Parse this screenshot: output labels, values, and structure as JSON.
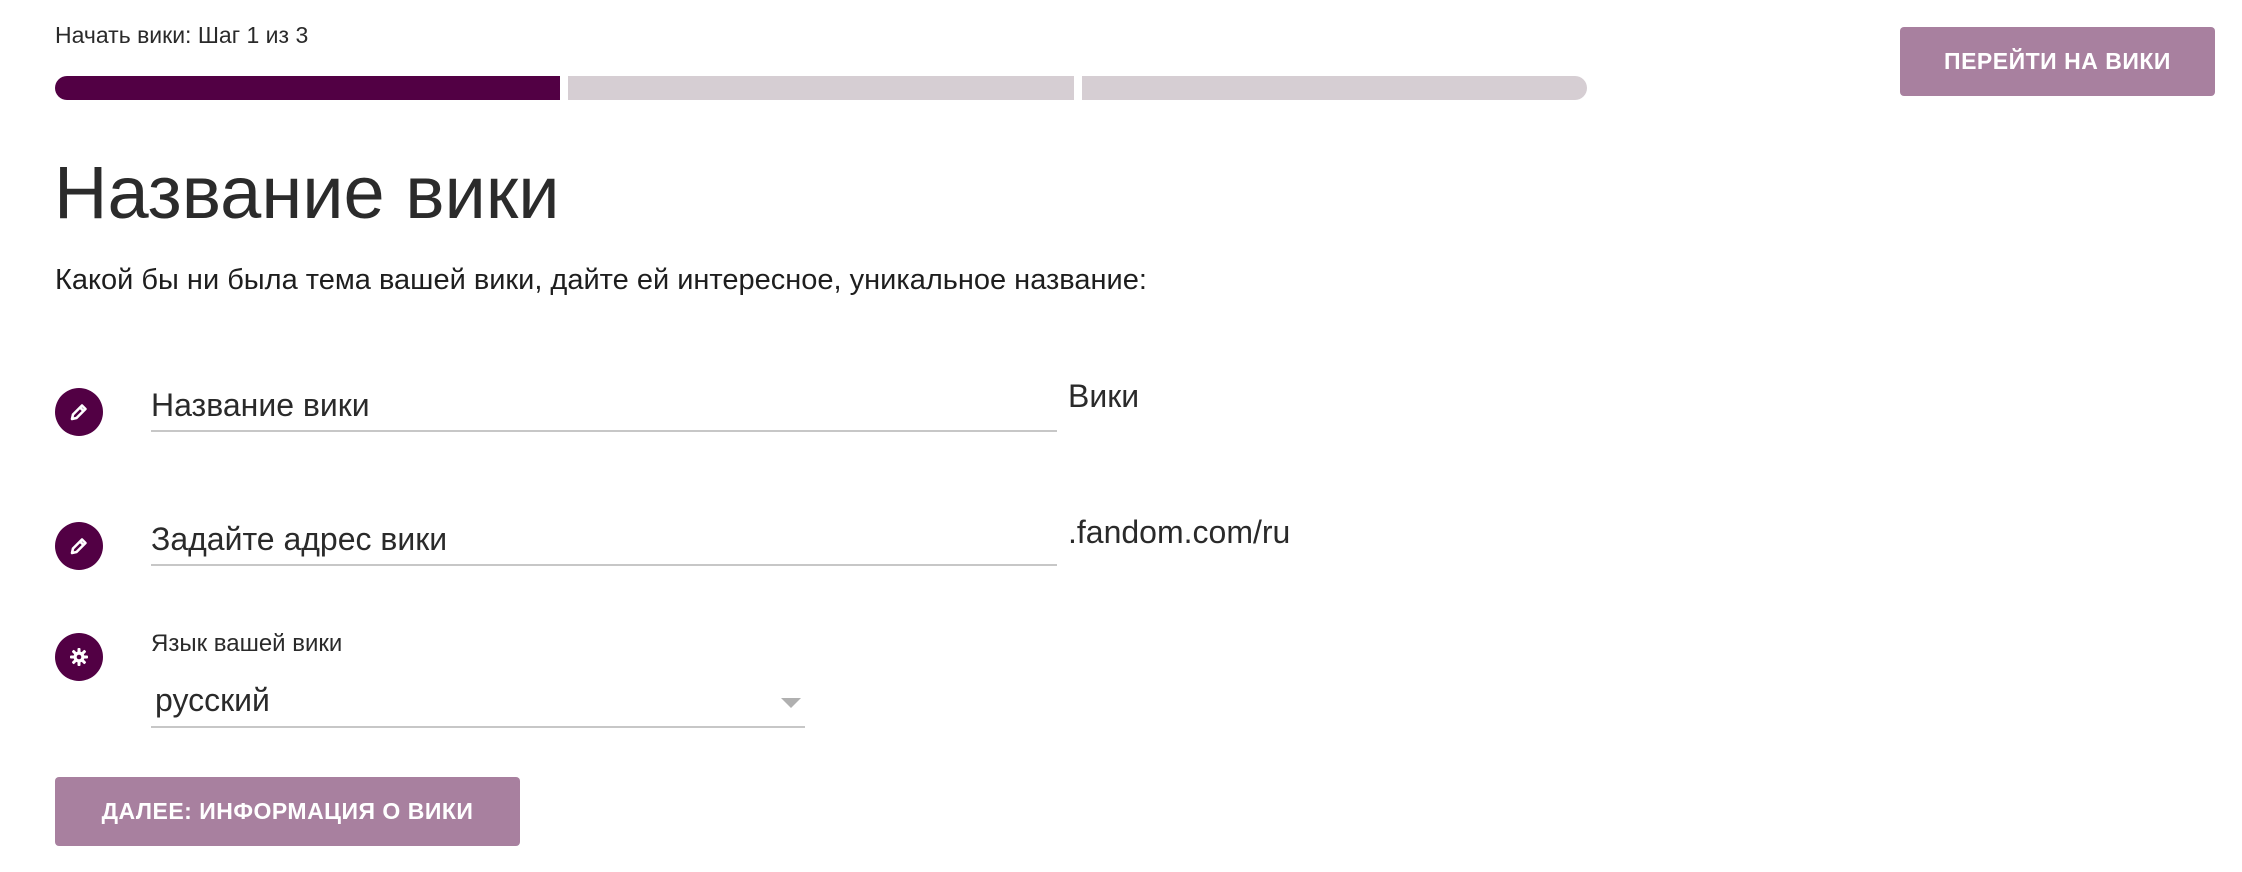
{
  "header": {
    "step_label": "Начать вики: Шаг 1 из 3",
    "go_to_wiki_label": "ПЕРЕЙТИ НА ВИКИ"
  },
  "progress": {
    "current_step": 1,
    "total_steps": 3,
    "active_color": "#520044",
    "inactive_color": "#d6ced3"
  },
  "main": {
    "title": "Название вики",
    "description": "Какой бы ни была тема вашей вики, дайте ей интересное, уникальное название:"
  },
  "form": {
    "wiki_name": {
      "icon": "pencil-icon",
      "placeholder": "Название вики",
      "value": "",
      "suffix": "Вики"
    },
    "wiki_address": {
      "icon": "pencil-icon",
      "placeholder": "Задайте адрес вики",
      "value": "",
      "suffix": ".fandom.com/ru"
    },
    "language": {
      "icon": "gear-icon",
      "label": "Язык вашей вики",
      "selected": "русский"
    }
  },
  "footer": {
    "next_label": "ДАЛЕЕ: ИНФОРМАЦИЯ О ВИКИ"
  },
  "colors": {
    "brand": "#520044",
    "button": "#a8809f"
  }
}
